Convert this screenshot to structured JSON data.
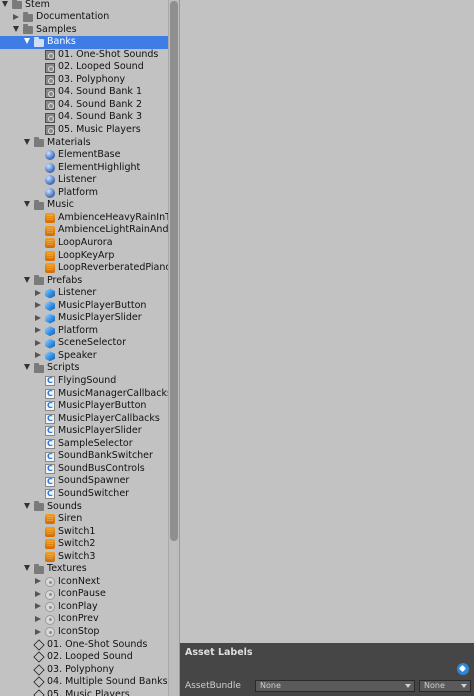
{
  "project_tree": {
    "rows": [
      {
        "label": "Stem",
        "indent": 0,
        "expand": "open",
        "icon": "folder-icon",
        "selected": false
      },
      {
        "label": "Documentation",
        "indent": 1,
        "expand": "closed",
        "icon": "folder-icon",
        "selected": false
      },
      {
        "label": "Samples",
        "indent": 1,
        "expand": "open",
        "icon": "folder-icon",
        "selected": false
      },
      {
        "label": "Banks",
        "indent": 2,
        "expand": "open",
        "icon": "folder-icon",
        "selected": true
      },
      {
        "label": "01. One-Shot Sounds",
        "indent": 3,
        "expand": "none",
        "icon": "sound-bank-icon",
        "selected": false
      },
      {
        "label": "02. Looped Sound",
        "indent": 3,
        "expand": "none",
        "icon": "sound-bank-icon",
        "selected": false
      },
      {
        "label": "03. Polyphony",
        "indent": 3,
        "expand": "none",
        "icon": "sound-bank-icon",
        "selected": false
      },
      {
        "label": "04. Sound Bank 1",
        "indent": 3,
        "expand": "none",
        "icon": "sound-bank-icon",
        "selected": false
      },
      {
        "label": "04. Sound Bank 2",
        "indent": 3,
        "expand": "none",
        "icon": "sound-bank-icon",
        "selected": false
      },
      {
        "label": "04. Sound Bank 3",
        "indent": 3,
        "expand": "none",
        "icon": "sound-bank-icon",
        "selected": false
      },
      {
        "label": "05. Music Players",
        "indent": 3,
        "expand": "none",
        "icon": "sound-bank-icon",
        "selected": false
      },
      {
        "label": "Materials",
        "indent": 2,
        "expand": "open",
        "icon": "folder-icon",
        "selected": false
      },
      {
        "label": "ElementBase",
        "indent": 3,
        "expand": "none",
        "icon": "material-icon",
        "selected": false
      },
      {
        "label": "ElementHighlight",
        "indent": 3,
        "expand": "none",
        "icon": "material-icon",
        "selected": false
      },
      {
        "label": "Listener",
        "indent": 3,
        "expand": "none",
        "icon": "material-icon",
        "selected": false
      },
      {
        "label": "Platform",
        "indent": 3,
        "expand": "none",
        "icon": "material-icon",
        "selected": false
      },
      {
        "label": "Music",
        "indent": 2,
        "expand": "open",
        "icon": "folder-icon",
        "selected": false
      },
      {
        "label": "AmbienceHeavyRainInTh",
        "indent": 3,
        "expand": "none",
        "icon": "audio-clip-icon",
        "selected": false
      },
      {
        "label": "AmbienceLightRainAndC",
        "indent": 3,
        "expand": "none",
        "icon": "audio-clip-icon",
        "selected": false
      },
      {
        "label": "LoopAurora",
        "indent": 3,
        "expand": "none",
        "icon": "audio-clip-icon",
        "selected": false
      },
      {
        "label": "LoopKeyArp",
        "indent": 3,
        "expand": "none",
        "icon": "audio-clip-icon",
        "selected": false
      },
      {
        "label": "LoopReverberatedPiano",
        "indent": 3,
        "expand": "none",
        "icon": "audio-clip-icon",
        "selected": false
      },
      {
        "label": "Prefabs",
        "indent": 2,
        "expand": "open",
        "icon": "folder-icon",
        "selected": false
      },
      {
        "label": "Listener",
        "indent": 3,
        "expand": "closed",
        "icon": "prefab-icon",
        "selected": false
      },
      {
        "label": "MusicPlayerButton",
        "indent": 3,
        "expand": "closed",
        "icon": "prefab-icon",
        "selected": false
      },
      {
        "label": "MusicPlayerSlider",
        "indent": 3,
        "expand": "closed",
        "icon": "prefab-icon",
        "selected": false
      },
      {
        "label": "Platform",
        "indent": 3,
        "expand": "closed",
        "icon": "prefab-icon",
        "selected": false
      },
      {
        "label": "SceneSelector",
        "indent": 3,
        "expand": "closed",
        "icon": "prefab-icon",
        "selected": false
      },
      {
        "label": "Speaker",
        "indent": 3,
        "expand": "closed",
        "icon": "prefab-icon",
        "selected": false
      },
      {
        "label": "Scripts",
        "indent": 2,
        "expand": "open",
        "icon": "folder-icon",
        "selected": false
      },
      {
        "label": "FlyingSound",
        "indent": 3,
        "expand": "none",
        "icon": "csharp-script-icon",
        "selected": false
      },
      {
        "label": "MusicManagerCallbacks",
        "indent": 3,
        "expand": "none",
        "icon": "csharp-script-icon",
        "selected": false
      },
      {
        "label": "MusicPlayerButton",
        "indent": 3,
        "expand": "none",
        "icon": "csharp-script-icon",
        "selected": false
      },
      {
        "label": "MusicPlayerCallbacks",
        "indent": 3,
        "expand": "none",
        "icon": "csharp-script-icon",
        "selected": false
      },
      {
        "label": "MusicPlayerSlider",
        "indent": 3,
        "expand": "none",
        "icon": "csharp-script-icon",
        "selected": false
      },
      {
        "label": "SampleSelector",
        "indent": 3,
        "expand": "none",
        "icon": "csharp-script-icon",
        "selected": false
      },
      {
        "label": "SoundBankSwitcher",
        "indent": 3,
        "expand": "none",
        "icon": "csharp-script-icon",
        "selected": false
      },
      {
        "label": "SoundBusControls",
        "indent": 3,
        "expand": "none",
        "icon": "csharp-script-icon",
        "selected": false
      },
      {
        "label": "SoundSpawner",
        "indent": 3,
        "expand": "none",
        "icon": "csharp-script-icon",
        "selected": false
      },
      {
        "label": "SoundSwitcher",
        "indent": 3,
        "expand": "none",
        "icon": "csharp-script-icon",
        "selected": false
      },
      {
        "label": "Sounds",
        "indent": 2,
        "expand": "open",
        "icon": "folder-icon",
        "selected": false
      },
      {
        "label": "Siren",
        "indent": 3,
        "expand": "none",
        "icon": "audio-clip-icon",
        "selected": false
      },
      {
        "label": "Switch1",
        "indent": 3,
        "expand": "none",
        "icon": "audio-clip-icon",
        "selected": false
      },
      {
        "label": "Switch2",
        "indent": 3,
        "expand": "none",
        "icon": "audio-clip-icon",
        "selected": false
      },
      {
        "label": "Switch3",
        "indent": 3,
        "expand": "none",
        "icon": "audio-clip-icon",
        "selected": false
      },
      {
        "label": "Textures",
        "indent": 2,
        "expand": "open",
        "icon": "folder-icon",
        "selected": false
      },
      {
        "label": "IconNext",
        "indent": 3,
        "expand": "closed",
        "icon": "texture-icon",
        "selected": false
      },
      {
        "label": "IconPause",
        "indent": 3,
        "expand": "closed",
        "icon": "texture-icon",
        "selected": false
      },
      {
        "label": "IconPlay",
        "indent": 3,
        "expand": "closed",
        "icon": "texture-icon",
        "selected": false
      },
      {
        "label": "IconPrev",
        "indent": 3,
        "expand": "closed",
        "icon": "texture-icon",
        "selected": false
      },
      {
        "label": "IconStop",
        "indent": 3,
        "expand": "closed",
        "icon": "texture-icon",
        "selected": false
      },
      {
        "label": "01. One-Shot Sounds",
        "indent": 2,
        "expand": "none",
        "icon": "unity-scene-icon",
        "selected": false
      },
      {
        "label": "02. Looped Sound",
        "indent": 2,
        "expand": "none",
        "icon": "unity-scene-icon",
        "selected": false
      },
      {
        "label": "03. Polyphony",
        "indent": 2,
        "expand": "none",
        "icon": "unity-scene-icon",
        "selected": false
      },
      {
        "label": "04. Multiple Sound Banks",
        "indent": 2,
        "expand": "none",
        "icon": "unity-scene-icon",
        "selected": false
      },
      {
        "label": "05. Music Players",
        "indent": 2,
        "expand": "none",
        "icon": "unity-scene-icon",
        "selected": false
      }
    ]
  },
  "asset_labels": {
    "title": "Asset Labels",
    "assetbundle_label": "AssetBundle",
    "bundle_value": "None",
    "variant_value": "None"
  },
  "colors": {
    "background": "#c2c2c2",
    "selection": "#3e7de6",
    "panel_dark": "#464646"
  }
}
